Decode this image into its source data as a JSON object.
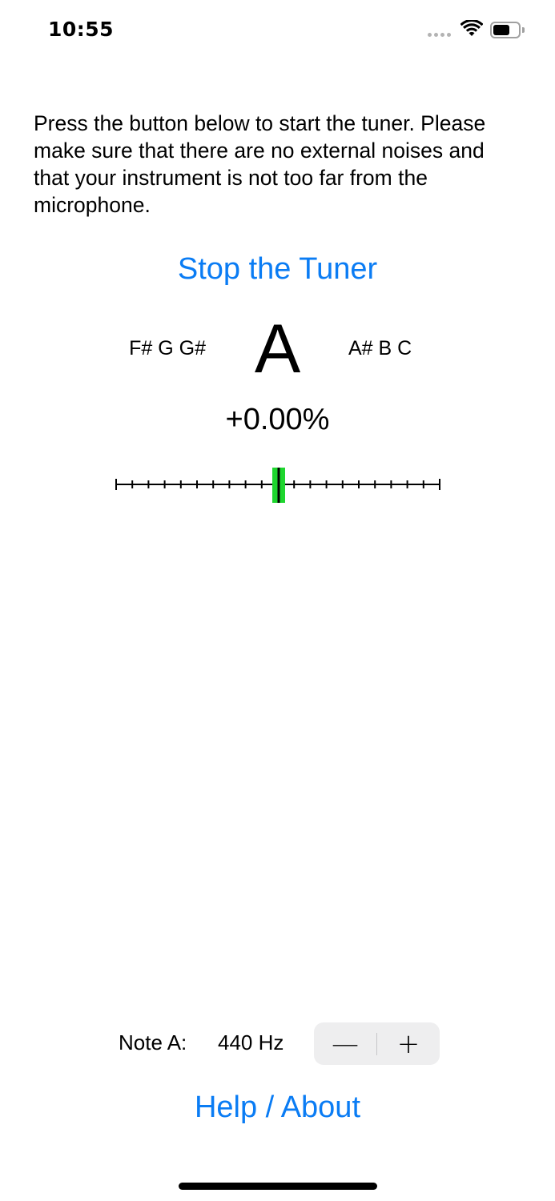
{
  "status_bar": {
    "time": "10:55",
    "icons": [
      "cellular-signal-icon",
      "wifi-icon",
      "battery-icon"
    ]
  },
  "instructions": "Press the button below to start the tuner. Please make sure that there are no external noises and that your instrument is not too far from the microphone.",
  "tuner": {
    "stop_button_label": "Stop the Tuner",
    "lower_notes": "F# G G#",
    "current_note": "A",
    "higher_notes": "A# B C",
    "deviation": "+0.00%",
    "indicator_position": 0.5,
    "indicator_color": "#1ed62e"
  },
  "reference": {
    "label": "Note A:",
    "value": "440 Hz",
    "decrement_label": "—",
    "increment_label": "+"
  },
  "help_label": "Help / About",
  "colors": {
    "accent": "#0a7cf4",
    "stepper_bg": "#eeeeef"
  }
}
